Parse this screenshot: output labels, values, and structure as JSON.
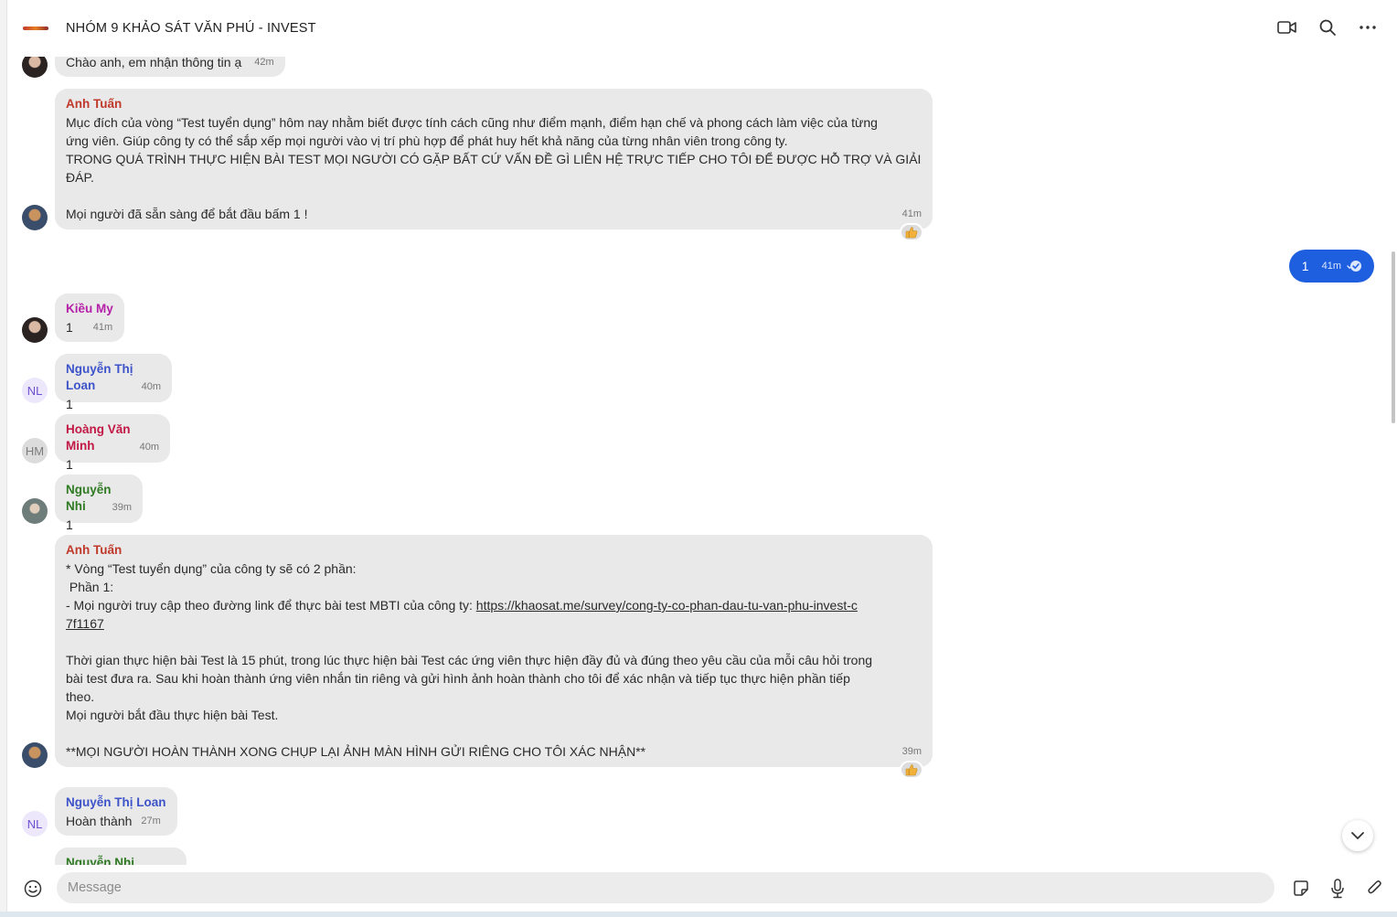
{
  "header": {
    "title": "NHÓM 9 KHẢO SÁT VĂN PHÚ - INVEST",
    "icons": [
      "video-call-icon",
      "search-icon",
      "more-options-icon"
    ]
  },
  "messages": [
    {
      "text": "Chào anh, em nhận thông tin ạ",
      "time": "42m"
    },
    {
      "sender": "Anh Tuấn",
      "lines": [
        "Mục đích của vòng “Test tuyển dụng” hôm nay nhằm biết được tính cách cũng như điểm mạnh, điểm hạn chế và phong cách làm việc của từng",
        "ứng viên. Giúp công ty có thể sắp xếp mọi người vào vị trí phù hợp để  phát huy hết khả năng của từng nhân viên trong công ty.",
        "TRONG QUÁ TRÌNH THỰC HIỆN BÀI TEST MỌI NGƯỜI CÓ GẶP BẤT CỨ VẤN ĐỀ GÌ LIÊN HỆ TRỰC TIẾP CHO TÔI ĐỂ ĐƯỢC HỖ TRỢ VÀ GIẢI",
        "ĐÁP.",
        "Mọi người đã sẵn sàng để bắt đầu bấm 1 !"
      ],
      "time": "41m",
      "reaction": "thumbs-up-icon"
    },
    {
      "text": "1",
      "time": "41m",
      "status": "seen-icon"
    },
    {
      "sender": "Kiều My",
      "text": "1",
      "time": "41m"
    },
    {
      "sender": "Nguyễn Thị Loan",
      "avatar": "NL",
      "text": "1",
      "time": "40m"
    },
    {
      "sender": "Hoàng Văn Minh",
      "avatar": "HM",
      "text": "1",
      "time": "40m"
    },
    {
      "sender": "Nguyễn Nhi",
      "text": "1",
      "time": "39m"
    },
    {
      "sender": "Anh Tuấn",
      "l1": "* Vòng “Test tuyển dụng” của công ty sẽ có 2 phần:",
      "l2": " Phần 1:",
      "l3_prefix": "- Mọi người truy cập theo đường link để thực bài test MBTI của công ty: ",
      "link_a": "https://khaosat.me/survey/cong-ty-co-phan-dau-tu-van-phu-invest-c",
      "link_b": "7f1167",
      "l4": "Thời gian thực hiện bài Test là 15 phút, trong lúc thực hiện bài Test các ứng viên thực hiện đầy đủ và đúng theo yêu cầu của mỗi câu hỏi trong",
      "l5": "bài test đưa ra. Sau khi hoàn thành ứng viên nhắn tin riêng và gửi hình ảnh hoàn thành cho tôi để  xác nhận và tiếp tục thực hiện phần tiếp",
      "l6": "theo.",
      "l7": "Mọi người bắt đầu thực hiện bài Test.",
      "l8": "**MỌI NGƯỜI HOÀN THÀNH XONG CHỤP LẠI ẢNH MÀN HÌNH GỬI RIÊNG CHO TÔI XÁC NHẬN**",
      "time": "39m",
      "reaction": "thumbs-up-icon"
    },
    {
      "sender": "Nguyễn Thị Loan",
      "avatar": "NL",
      "text": "Hoàn thành",
      "time": "27m"
    },
    {
      "sender": "Nguyễn Nhi"
    }
  ],
  "composer": {
    "placeholder": "Message",
    "icons": [
      "emoji-icon",
      "sticker-icon",
      "microphone-icon",
      "attachment-icon"
    ]
  },
  "colors": {
    "own_bubble": "#1e5fe0",
    "other_bubble": "#e9e9e9",
    "sender_anh_tuan": "#c0392b",
    "sender_kieu_my": "#b51fa7",
    "sender_nguyen_thi_loan": "#3d53c9",
    "sender_hoang_van_minh": "#c21845",
    "sender_nguyen_nhi": "#2f7a23"
  }
}
